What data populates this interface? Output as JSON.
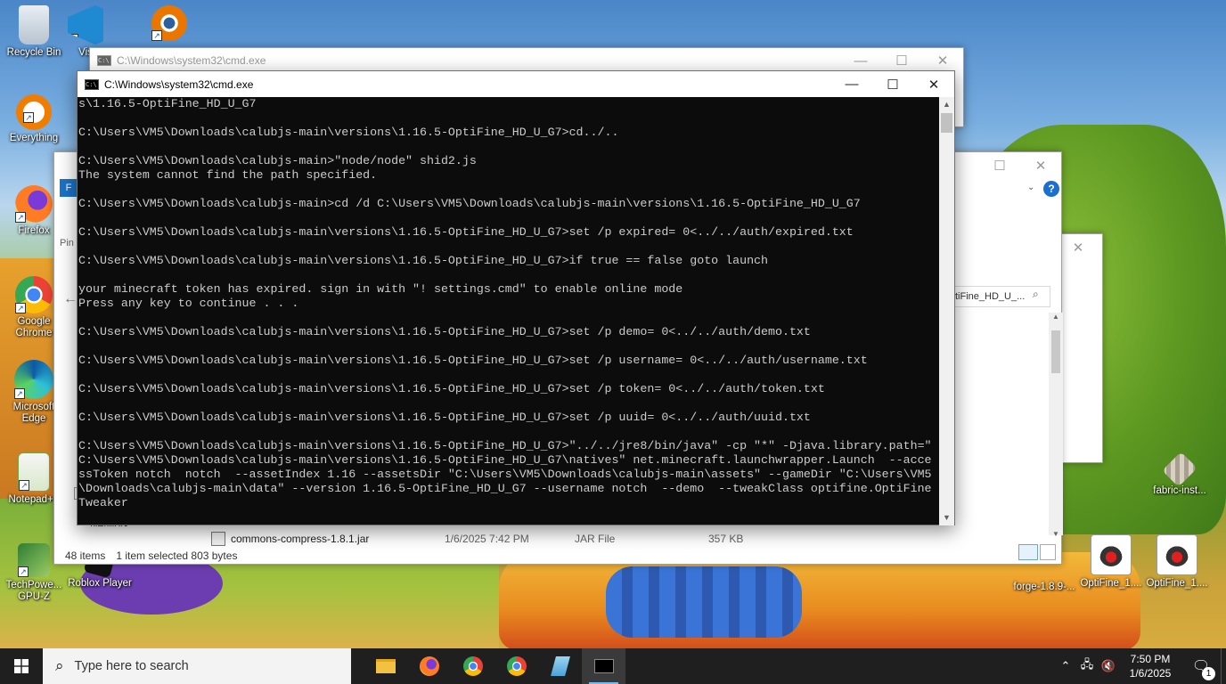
{
  "desktop": {
    "icons": [
      {
        "label": "Recycle Bin"
      },
      {
        "label": "Vis"
      },
      {
        "label": ""
      },
      {
        "label": "Everything"
      },
      {
        "label": "Firefox"
      },
      {
        "label": "Google Chrome"
      },
      {
        "label": "Microsoft Edge"
      },
      {
        "label": "Notepad++"
      },
      {
        "label": "TechPowe... GPU-Z"
      },
      {
        "label": "Roblox Player"
      },
      {
        "label": "fabric-inst..."
      },
      {
        "label": "forge-1.8.9-..."
      },
      {
        "label": "OptiFine_1...."
      },
      {
        "label": "OptiFine_1...."
      }
    ]
  },
  "cmd_back": {
    "title": "C:\\Windows\\system32\\cmd.exe"
  },
  "explorer": {
    "address_partial": "tiFine_HD_U_...",
    "file_row": {
      "name": "commons-compress-1.8.1.jar",
      "date": "1/6/2025 7:42 PM",
      "type": "JAR File",
      "size": "357 KB"
    },
    "status": {
      "items": "48 items",
      "selected": "1 item selected  803 bytes"
    },
    "nav_partial": "Pin",
    "ribbon_partial": "F",
    "network_partial": "Network"
  },
  "cmd": {
    "title": "C:\\Windows\\system32\\cmd.exe",
    "lines": [
      "s\\1.16.5-OptiFine_HD_U_G7",
      "",
      "C:\\Users\\VM5\\Downloads\\calubjs-main\\versions\\1.16.5-OptiFine_HD_U_G7>cd../..",
      "",
      "C:\\Users\\VM5\\Downloads\\calubjs-main>\"node/node\" shid2.js",
      "The system cannot find the path specified.",
      "",
      "C:\\Users\\VM5\\Downloads\\calubjs-main>cd /d C:\\Users\\VM5\\Downloads\\calubjs-main\\versions\\1.16.5-OptiFine_HD_U_G7",
      "",
      "C:\\Users\\VM5\\Downloads\\calubjs-main\\versions\\1.16.5-OptiFine_HD_U_G7>set /p expired= 0<../../auth/expired.txt",
      "",
      "C:\\Users\\VM5\\Downloads\\calubjs-main\\versions\\1.16.5-OptiFine_HD_U_G7>if true == false goto launch",
      "",
      "your minecraft token has expired. sign in with \"! settings.cmd\" to enable online mode",
      "Press any key to continue . . .",
      "",
      "C:\\Users\\VM5\\Downloads\\calubjs-main\\versions\\1.16.5-OptiFine_HD_U_G7>set /p demo= 0<../../auth/demo.txt",
      "",
      "C:\\Users\\VM5\\Downloads\\calubjs-main\\versions\\1.16.5-OptiFine_HD_U_G7>set /p username= 0<../../auth/username.txt",
      "",
      "C:\\Users\\VM5\\Downloads\\calubjs-main\\versions\\1.16.5-OptiFine_HD_U_G7>set /p token= 0<../../auth/token.txt",
      "",
      "C:\\Users\\VM5\\Downloads\\calubjs-main\\versions\\1.16.5-OptiFine_HD_U_G7>set /p uuid= 0<../../auth/uuid.txt",
      "",
      "C:\\Users\\VM5\\Downloads\\calubjs-main\\versions\\1.16.5-OptiFine_HD_U_G7>\"../../jre8/bin/java\" -cp \"*\" -Djava.library.path=\"",
      "C:\\Users\\VM5\\Downloads\\calubjs-main\\versions\\1.16.5-OptiFine_HD_U_G7\\natives\" net.minecraft.launchwrapper.Launch  --acce",
      "ssToken notch  notch  --assetIndex 1.16 --assetsDir \"C:\\Users\\VM5\\Downloads\\calubjs-main\\assets\" --gameDir \"C:\\Users\\VM5",
      "\\Downloads\\calubjs-main\\data\" --version 1.16.5-OptiFine_HD_U_G7 --username notch  --demo  --tweakClass optifine.OptiFine",
      "Tweaker"
    ]
  },
  "taskbar": {
    "search_placeholder": "Type here to search",
    "time": "7:50 PM",
    "date": "1/6/2025",
    "notification_count": "1"
  }
}
